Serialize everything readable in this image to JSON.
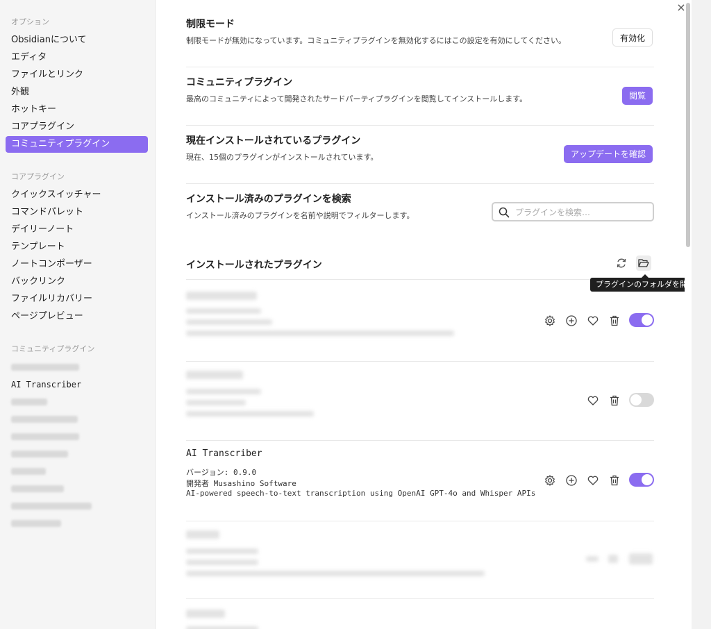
{
  "window": {
    "close_glyph": "×"
  },
  "sidebar": {
    "section_options": "オプション",
    "options": [
      {
        "label": "Obsidianについて"
      },
      {
        "label": "エディタ"
      },
      {
        "label": "ファイルとリンク"
      },
      {
        "label": "外観"
      },
      {
        "label": "ホットキー"
      },
      {
        "label": "コアプラグイン"
      },
      {
        "label": "コミュニティプラグイン",
        "active": true
      }
    ],
    "section_core": "コアプラグイン",
    "core": [
      {
        "label": "クイックスイッチャー"
      },
      {
        "label": "コマンドパレット"
      },
      {
        "label": "デイリーノート"
      },
      {
        "label": "テンプレート"
      },
      {
        "label": "ノートコンポーザー"
      },
      {
        "label": "バックリンク"
      },
      {
        "label": "ファイルリカバリー"
      },
      {
        "label": "ページプレビュー"
      }
    ],
    "section_community": "コミュニティプラグイン",
    "community_visible": "AI Transcriber"
  },
  "settings": {
    "restricted": {
      "title": "制限モード",
      "desc": "制限モードが無効になっています。コミュニティプラグインを無効化するにはこの設定を有効にしてください。",
      "button": "有効化"
    },
    "community": {
      "title": "コミュニティプラグイン",
      "desc": "最高のコミュニティによって開発されたサードパーティプラグインを閲覧してインストールします。",
      "button": "閲覧"
    },
    "installed_now": {
      "title": "現在インストールされているプラグイン",
      "desc": "現在、15個のプラグインがインストールされています。",
      "button": "アップデートを確認"
    },
    "search": {
      "title": "インストール済みのプラグインを検索",
      "desc": "インストール済みのプラグインを名前や説明でフィルターします。",
      "placeholder": "プラグインを検索…"
    }
  },
  "installed_section": {
    "title": "インストールされたプラグイン",
    "tooltip": "プラグインのフォルダを開く"
  },
  "plugins": [
    {
      "name": "AI Transcriber",
      "version": "バージョン: 0.9.0",
      "author": "開発者 Musashino Software",
      "description": "AI-powered speech-to-text transcription using OpenAI GPT-4o and Whisper APIs",
      "enabled": true
    }
  ],
  "accent_color": "#8b6cf0",
  "icons": [
    "close-icon",
    "search-icon",
    "refresh-icon",
    "folder-open-icon",
    "gear-icon",
    "plus-circle-icon",
    "heart-icon",
    "trash-icon",
    "toggle-switch"
  ]
}
